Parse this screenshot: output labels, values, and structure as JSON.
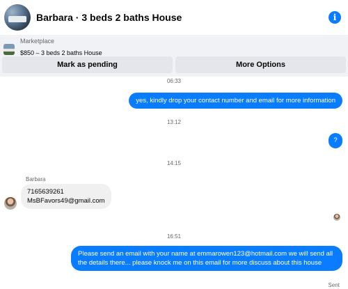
{
  "header": {
    "title": "Barbara · 3 beds 2 baths House",
    "avatar_icon": "house-avatar-icon",
    "info_icon": "info-icon",
    "info_glyph": "i",
    "accent": "#0a7cff"
  },
  "listing": {
    "marketplace_label": "Marketplace",
    "price_title": "$850 – 3 beds 2 baths House"
  },
  "actions": {
    "mark_pending": "Mark as pending",
    "more_options": "More Options"
  },
  "conversation": {
    "timestamps": [
      "06:33",
      "13:12",
      "14:15",
      "16:51"
    ],
    "sender_name": "Barbara",
    "messages": {
      "m1": "yes, kindly drop your contact number and email for more information",
      "m2": "?",
      "m3_line1": "7165639261",
      "m3_line2": "MsBFavors49@gmail.com",
      "m4": "Please send an email with your name at emmarowen123@hotmail.com we will send all the details there... please knock me on this email for more discuss about this house"
    },
    "sent_status": "Sent"
  }
}
